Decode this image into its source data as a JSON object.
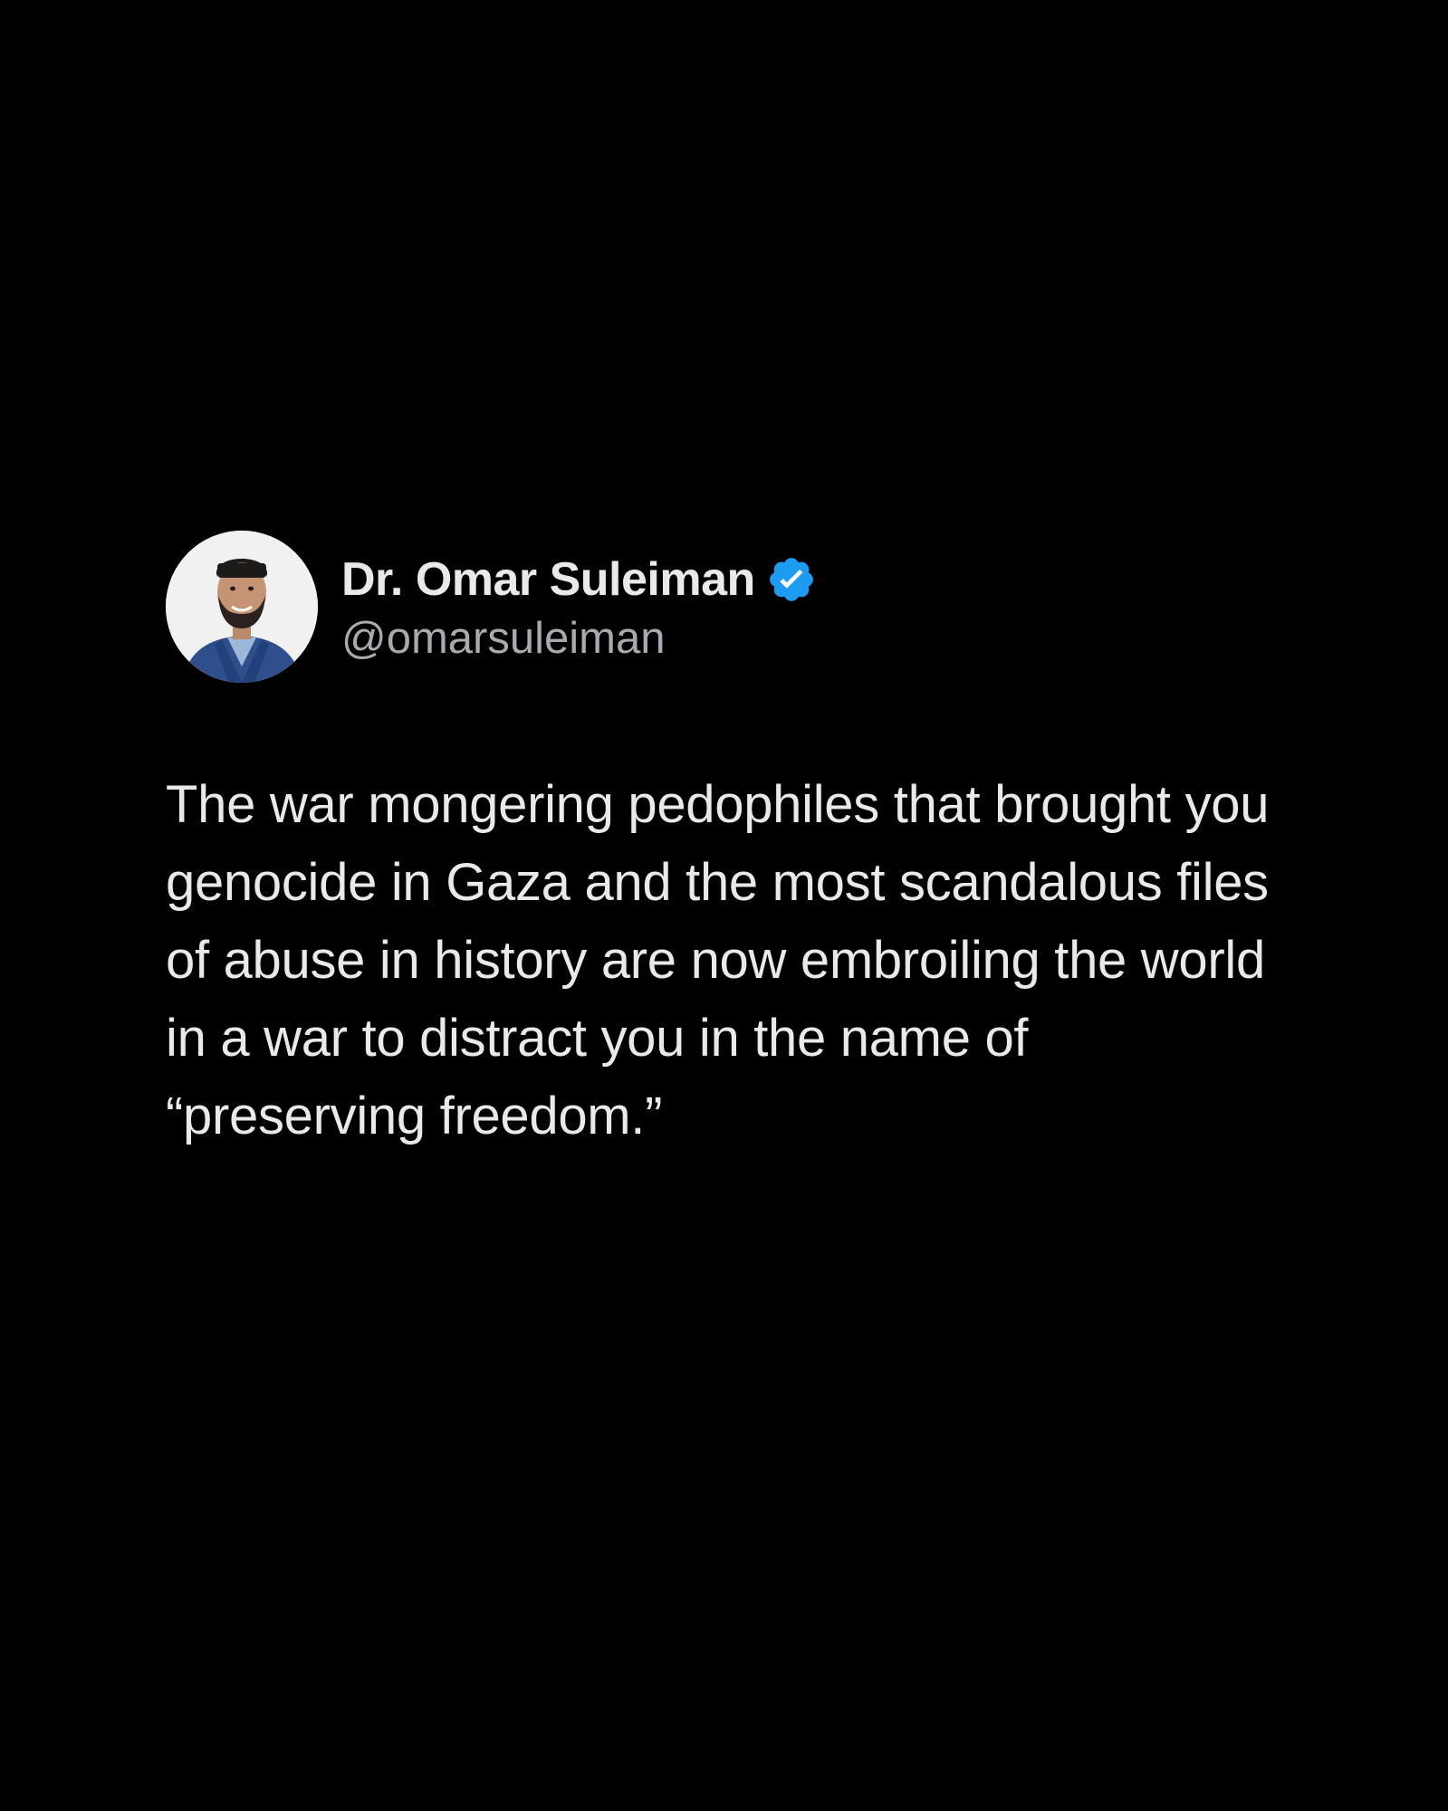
{
  "tweet": {
    "author": {
      "display_name": "Dr. Omar Suleiman",
      "handle": "@omarsuleiman",
      "verified": true,
      "avatar_icon": "profile-photo"
    },
    "text": "The war mongering pedophiles that brought you genocide in Gaza and the most scandalous files of abuse in history are now embroiling the world in a war to distract you in the name of “preserving freedom.”"
  },
  "colors": {
    "background": "#000000",
    "primary_text": "#e7e9ea",
    "secondary_text": "#a6abaf",
    "verified_badge": "#1d9bf0"
  }
}
